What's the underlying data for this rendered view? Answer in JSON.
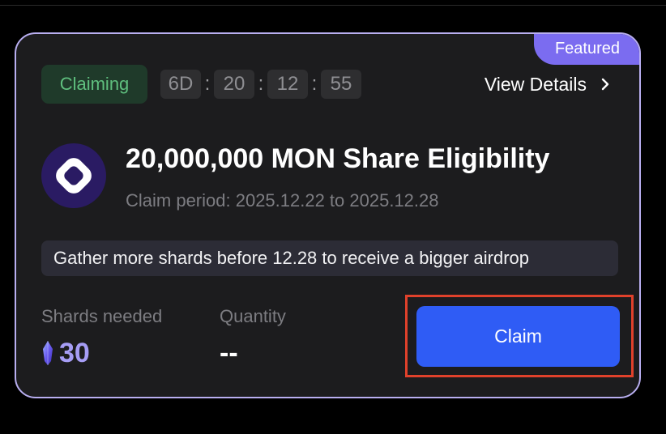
{
  "card": {
    "featured_label": "Featured",
    "status": "Claiming",
    "countdown": {
      "days": "6D",
      "hours": "20",
      "minutes": "12",
      "seconds": "55",
      "separator": ":"
    },
    "view_details_label": "View Details",
    "title": "20,000,000 MON Share Eligibility",
    "claim_period": "Claim period: 2025.12.22 to 2025.12.28",
    "notice": "Gather more shards before 12.28 to receive a bigger airdrop",
    "shards_needed_label": "Shards needed",
    "shards_needed_value": "30",
    "quantity_label": "Quantity",
    "quantity_value": "--",
    "claim_button_label": "Claim"
  },
  "icons": {
    "logo": "monad-logo-icon",
    "shard": "shard-crystal-icon",
    "chevron": "chevron-right-icon"
  },
  "colors": {
    "card_border": "#b8aef0",
    "featured_bg": "#7b6cf0",
    "status_bg": "#1f3a2a",
    "status_text": "#5fbf7e",
    "claim_button": "#2f5cf5",
    "highlight_border": "#e0412b",
    "shard_value": "#a69df5"
  }
}
